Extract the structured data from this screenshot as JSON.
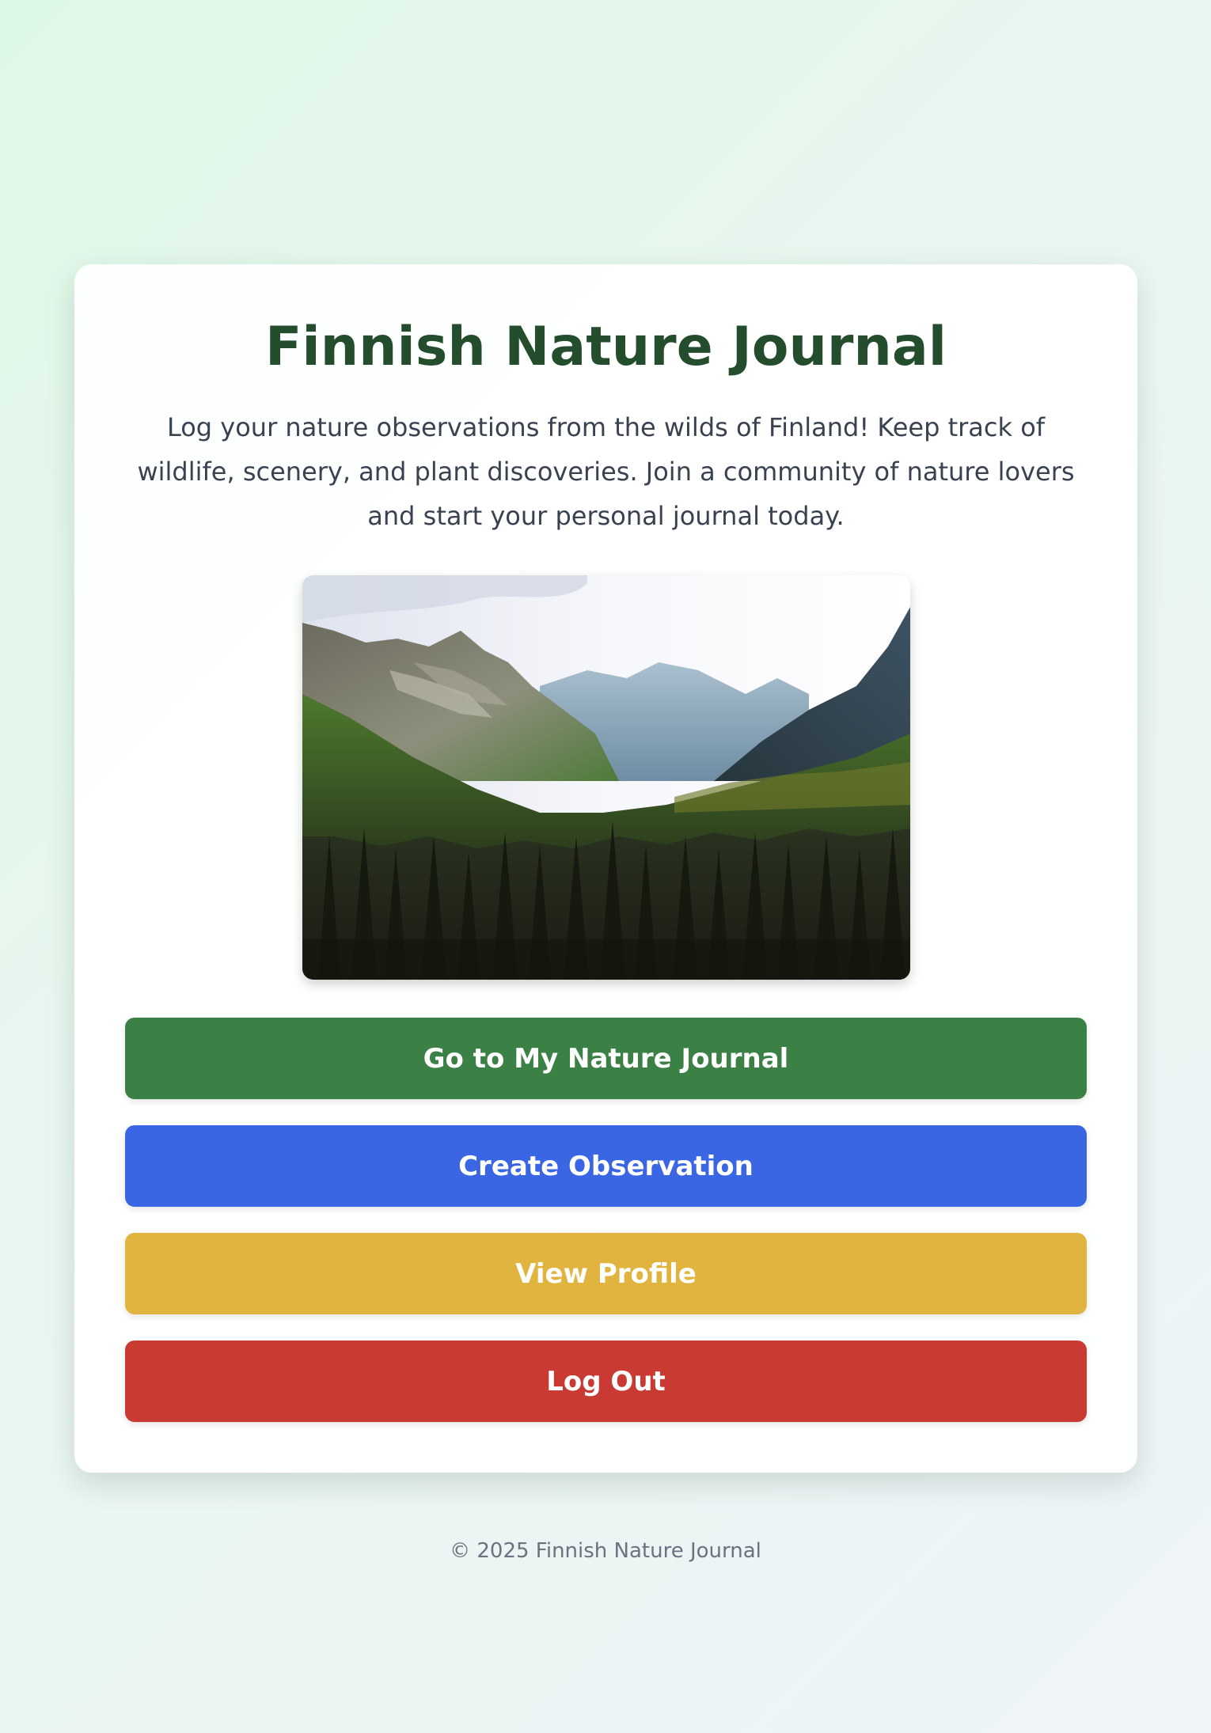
{
  "colors": {
    "title": "#234d2c",
    "journal_button": "#3b8044",
    "create_button": "#3a66e3",
    "profile_button": "#e1b43f",
    "logout_button": "#c93a33"
  },
  "card": {
    "title": "Finnish Nature Journal",
    "intro": "Log your nature observations from the wilds of Finland! Keep track of wildlife, scenery, and plant discoveries. Join a community of nature lovers and start your personal journal today."
  },
  "buttons": {
    "journal": "Go to My Nature Journal",
    "create": "Create Observation",
    "profile": "View Profile",
    "logout": "Log Out"
  },
  "footer": {
    "text": "© 2025 Finnish Nature Journal"
  }
}
